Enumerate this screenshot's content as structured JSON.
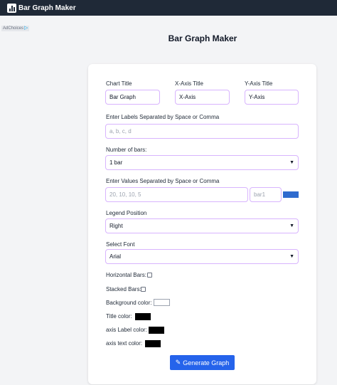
{
  "app": {
    "title": "Bar Graph Maker"
  },
  "ad": {
    "label": "AdChoices"
  },
  "page": {
    "title": "Bar Graph Maker"
  },
  "form": {
    "chart_title": {
      "label": "Chart Title",
      "value": "Bar Graph"
    },
    "x_axis_title": {
      "label": "X-Axis Title",
      "value": "X-Axis"
    },
    "y_axis_title": {
      "label": "Y-Axis Title",
      "value": "Y-Axis"
    },
    "labels": {
      "label": "Enter Labels Separated by Space or Comma",
      "placeholder": "a, b, c, d"
    },
    "num_bars": {
      "label": "Number of bars:",
      "value": "1 bar"
    },
    "values": {
      "label": "Enter Values Separated by Space or Comma",
      "placeholder": "20, 10, 10, 5",
      "series_placeholder": "bar1",
      "series_color": "#2f6bce"
    },
    "legend_position": {
      "label": "Legend Position",
      "value": "Right"
    },
    "font": {
      "label": "Select Font",
      "value": "Arial"
    },
    "horizontal_bars": {
      "label": "Horizontal Bars:",
      "checked": false
    },
    "stacked_bars": {
      "label": "Stacked Bars:",
      "checked": false
    },
    "background_color": {
      "label": "Background color:",
      "value": "#ffffff"
    },
    "title_color": {
      "label": "Title color:",
      "value": "#000000"
    },
    "axis_label_color": {
      "label": "axis Label color:",
      "value": "#000000"
    },
    "axis_text_color": {
      "label": "axis text color:",
      "value": "#000000"
    },
    "generate_button": {
      "label": "Generate Graph",
      "icon": "pencil-icon"
    }
  }
}
